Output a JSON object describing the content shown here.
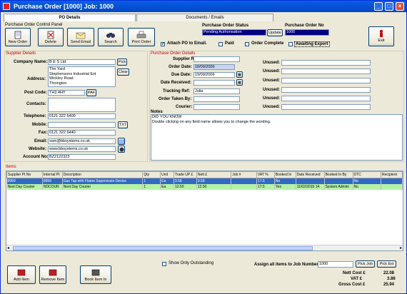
{
  "window": {
    "title": "Purchase Order [1000]  Job: 1000"
  },
  "tabs": [
    "PO Details",
    "Documents / Emails"
  ],
  "control_panel": {
    "title": "Purchase Order Control Panel",
    "buttons": [
      "New Order",
      "Delete",
      "Send Email",
      "Search",
      "Print Order"
    ]
  },
  "status": {
    "label": "Purchase Order Status",
    "value": "Pending Authorisation",
    "update": "Update",
    "po_no_label": "Purchase Order No",
    "po_no": "1000"
  },
  "options": {
    "attach": "Attach PO to Email.",
    "paid": "Paid",
    "complete": "Order Complete",
    "awaiting": "Awaiting Export",
    "attach_checked": "✓"
  },
  "exit": "Exit",
  "supplier": {
    "title": "Supplier Details",
    "company_label": "Company Name:",
    "company": "B E S Ltd",
    "pick": "Pick",
    "address_label": "Address:",
    "address": [
      "The Yard",
      "Stephensons Industrial Est",
      "Wickley Road",
      "Thoington"
    ],
    "clear": "Clear",
    "postcode_label": "Post Code:",
    "postcode": "TH3 4HY",
    "paf": "PAF",
    "contacts_label": "Contacts:",
    "telephone_label": "Telephone:",
    "telephone": "0121 322 6400",
    "mobile_label": "Mobile:",
    "txt": "TXT",
    "fax_label": "Fax:",
    "fax": "0121 322 6440",
    "email_label": "Email:",
    "email": "sam@bbsystems.co.uk",
    "website_label": "Website:",
    "website": "www.bbsystems.co.uk",
    "account_label": "Account No:",
    "account": "BZ2122323"
  },
  "po_details": {
    "title": "Purchase Order Details",
    "ref_label": "Supplier Ref:",
    "order_date_label": "Order Date:",
    "order_date": "18/09/2006",
    "due_date_label": "Due Date:",
    "due_date": "19/09/2006",
    "received_label": "Date Received:",
    "tracking_label": "Tracking Ref:",
    "tracking": "Julia",
    "taken_label": "Order Taken By:",
    "courier_label": "Courier:",
    "unused": "Unused:"
  },
  "notes": {
    "title": "Notes",
    "lines": [
      "DID YOU KNOW",
      "Double clicking on any field name allows you to change the wording."
    ]
  },
  "items": {
    "title": "Items",
    "columns": [
      "Supplier Pt No",
      "Internal Pt",
      "Description",
      "Qty",
      "Unit",
      "Trade UP £",
      "Nett £",
      "Job #",
      "VAT %",
      "Booked In",
      "Date Received",
      "Booked In By",
      "DTC",
      "Recipient"
    ],
    "rows": [
      [
        "8959",
        "8959",
        "Gas Tap with Flame Supervision Device",
        "1",
        "Ea",
        "9.58",
        "9.58",
        "",
        "17.5",
        "No",
        "",
        "",
        "No",
        ""
      ],
      [
        "Next Day Courier",
        "NDCOUR",
        "Next Day Courier",
        "1",
        "Ea",
        "12.50",
        "12.50",
        "",
        "17.5",
        "Yes",
        "11/02/2016 14",
        "System Admini",
        "No",
        ""
      ]
    ]
  },
  "footer": {
    "show_outstanding": "Show Only Outstanding",
    "assign_label": "Assign all items to Job Number:",
    "job_no": "1000",
    "pick_job": "Pick Job",
    "pick_est": "Pick Est",
    "add_item": "Add Item",
    "remove_item": "Remove Item",
    "book_item": "Book Item In",
    "net_label": "Nett Cost £",
    "net": "22.08",
    "vat_label": "VAT £",
    "vat": "3.86",
    "gross_label": "Gross Cost £",
    "gross": "25.94"
  }
}
